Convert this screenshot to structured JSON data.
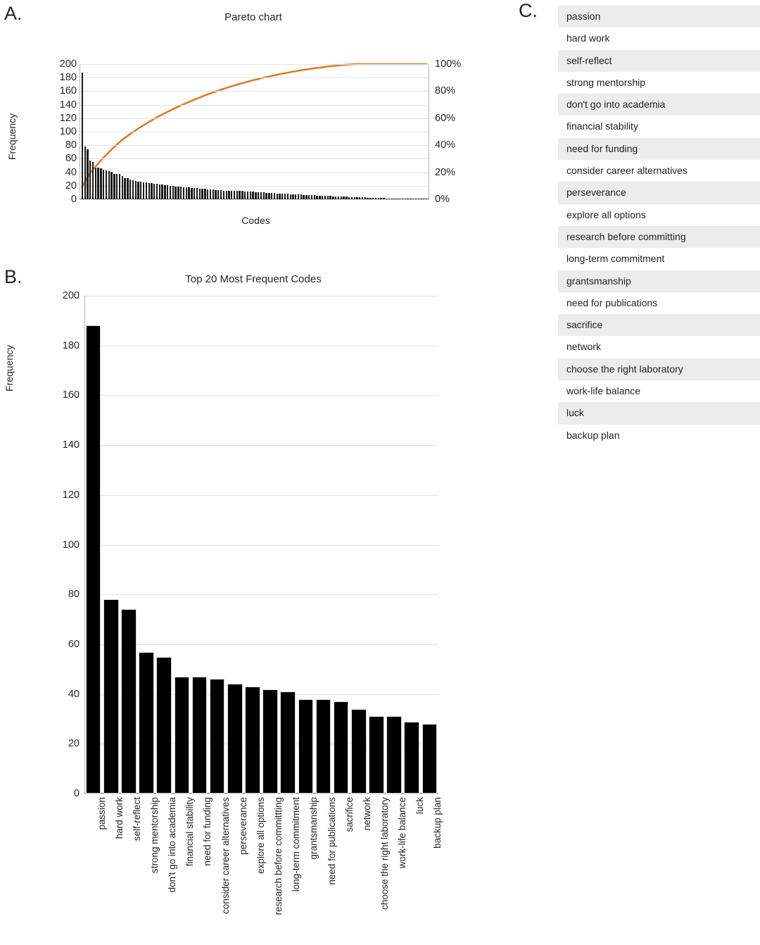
{
  "panels": {
    "a_label": "A.",
    "b_label": "B.",
    "c_label": "C."
  },
  "chart_data": [
    {
      "type": "bar",
      "id": "pareto",
      "title": "Pareto chart",
      "xlabel": "Codes",
      "ylabel": "Frequency",
      "ylim": [
        0,
        200
      ],
      "yticks": [
        0,
        20,
        40,
        60,
        80,
        100,
        120,
        140,
        160,
        180,
        200
      ],
      "y2label": "",
      "y2lim": [
        0,
        100
      ],
      "y2ticks": [
        "0%",
        "20%",
        "40%",
        "60%",
        "80%",
        "100%"
      ],
      "grid": true,
      "legend": "none",
      "bar_color": "#1a1a1a",
      "line_color": "#E07B2A",
      "series": [
        {
          "name": "Frequency",
          "values": [
            188,
            78,
            74,
            57,
            55,
            47,
            47,
            46,
            44,
            43,
            42,
            41,
            38,
            38,
            37,
            34,
            31,
            31,
            29,
            28,
            27,
            26,
            26,
            25,
            25,
            24,
            24,
            23,
            23,
            22,
            22,
            21,
            21,
            20,
            20,
            19,
            19,
            19,
            18,
            18,
            18,
            17,
            17,
            17,
            16,
            16,
            16,
            15,
            15,
            15,
            14,
            14,
            14,
            13,
            13,
            13,
            13,
            12,
            12,
            12,
            12,
            11,
            11,
            11,
            11,
            10,
            10,
            10,
            10,
            9,
            9,
            9,
            9,
            8,
            8,
            8,
            8,
            8,
            7,
            7,
            7,
            7,
            7,
            6,
            6,
            6,
            6,
            6,
            5,
            5,
            5,
            5,
            5,
            5,
            4,
            4,
            4,
            4,
            4,
            4,
            3,
            3,
            3,
            3,
            3,
            3,
            3,
            2,
            2,
            2,
            2,
            2,
            2,
            2,
            1,
            1,
            1,
            1,
            1,
            1,
            1,
            1,
            1,
            1,
            1,
            1,
            1,
            1,
            1,
            1
          ]
        },
        {
          "name": "Cumulative %",
          "values": [
            9.1,
            12.9,
            16.5,
            19.2,
            21.9,
            24.2,
            26.4,
            28.7,
            30.8,
            32.9,
            34.9,
            36.9,
            38.7,
            40.5,
            42.3,
            44.0,
            45.5,
            46.9,
            48.4,
            49.7,
            51.0,
            52.3,
            53.6,
            54.8,
            56.0,
            57.2,
            58.3,
            59.5,
            60.6,
            61.7,
            62.7,
            63.8,
            64.8,
            65.7,
            66.7,
            67.6,
            68.5,
            69.4,
            70.3,
            71.2,
            72.0,
            72.9,
            73.7,
            74.5,
            75.3,
            76.1,
            76.9,
            77.6,
            78.3,
            79.1,
            79.7,
            80.4,
            81.1,
            81.7,
            82.4,
            83.0,
            83.6,
            84.2,
            84.8,
            85.4,
            85.9,
            86.5,
            87.0,
            87.5,
            88.1,
            88.5,
            89.0,
            89.5,
            90.0,
            90.4,
            90.8,
            91.3,
            91.7,
            92.1,
            92.5,
            92.9,
            93.3,
            93.7,
            94.0,
            94.4,
            94.7,
            95.1,
            95.4,
            95.7,
            96.0,
            96.3,
            96.6,
            96.9,
            97.2,
            97.4,
            97.7,
            97.9,
            98.2,
            98.4,
            98.6,
            98.8,
            99.0,
            99.2,
            99.4,
            99.6,
            99.7,
            99.8,
            99.9,
            100.0,
            100.0,
            100.0,
            100.0,
            100.0,
            100.0,
            100.0,
            100.0,
            100.0,
            100.0,
            100.0,
            100.0,
            100.0,
            100.0,
            100.0,
            100.0,
            100.0,
            100.0,
            100.0,
            100.0,
            100.0,
            100.0,
            100.0,
            100.0,
            100.0,
            100.0,
            100.0
          ]
        }
      ]
    },
    {
      "type": "bar",
      "id": "top20",
      "title": "Top 20 Most Frequent Codes",
      "xlabel": "",
      "ylabel": "Frequency",
      "ylim": [
        0,
        200
      ],
      "yticks": [
        0,
        20,
        40,
        60,
        80,
        100,
        120,
        140,
        160,
        180,
        200
      ],
      "grid": true,
      "legend": "none",
      "bar_color": "#000000",
      "categories": [
        "passion",
        "hard work",
        "self-reflect",
        "strong mentorship",
        "don't go into academia",
        "financial stability",
        "need for funding",
        "consider career alternatives",
        "perseverance",
        "explore all options",
        "research before committting",
        "long-term commitment",
        "grantsmanship",
        "need for publications",
        "sacrifice",
        "network",
        "choose the right laboratory",
        "work-life balance",
        "luck",
        "backup plan"
      ],
      "values": [
        188,
        78,
        74,
        57,
        55,
        47,
        47,
        46,
        44,
        43,
        42,
        41,
        38,
        38,
        37,
        34,
        31,
        31,
        29,
        28
      ]
    }
  ],
  "codes_list": [
    "passion",
    "hard work",
    "self-reflect",
    "strong mentorship",
    "don't go into academia",
    "financial stability",
    "need for funding",
    "consider career alternatives",
    "perseverance",
    "explore all options",
    "research before committing",
    "long-term commitment",
    "grantsmanship",
    "need for publications",
    "sacrifice",
    "network",
    "choose the right laboratory",
    "work-life balance",
    "luck",
    "backup plan"
  ]
}
